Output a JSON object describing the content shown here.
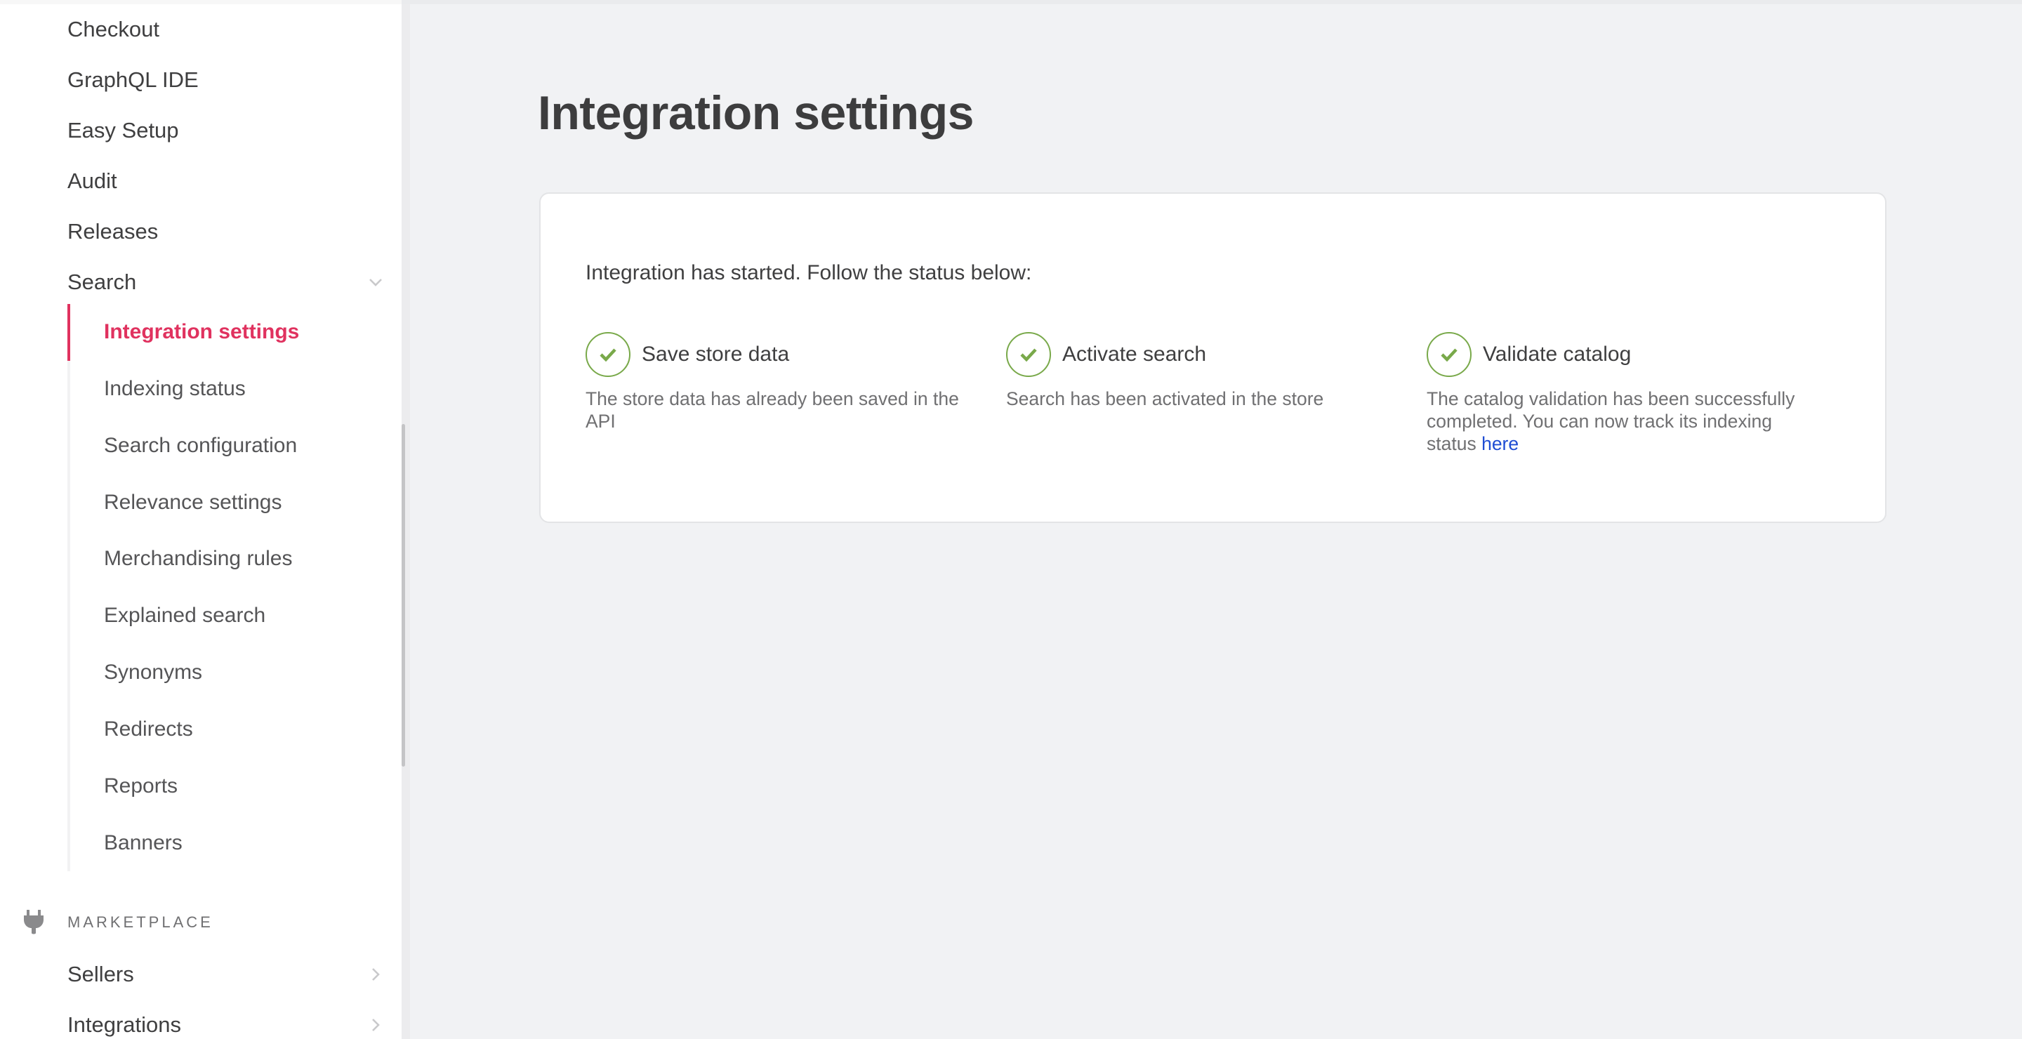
{
  "sidebar": {
    "top_items": [
      {
        "label": "Checkout"
      },
      {
        "label": "GraphQL IDE"
      },
      {
        "label": "Easy Setup"
      },
      {
        "label": "Audit"
      },
      {
        "label": "Releases"
      },
      {
        "label": "Search",
        "expanded": true,
        "icon": "chevron-down-icon"
      }
    ],
    "search_sub_items": [
      {
        "label": "Integration settings",
        "active": true
      },
      {
        "label": "Indexing status"
      },
      {
        "label": "Search configuration"
      },
      {
        "label": "Relevance settings"
      },
      {
        "label": "Merchandising rules"
      },
      {
        "label": "Explained search"
      },
      {
        "label": "Synonyms"
      },
      {
        "label": "Redirects"
      },
      {
        "label": "Reports"
      },
      {
        "label": "Banners"
      }
    ],
    "section": {
      "title": "MARKETPLACE",
      "icon": "plug-icon",
      "items": [
        {
          "label": "Sellers",
          "icon": "chevron-right-icon"
        },
        {
          "label": "Integrations",
          "icon": "chevron-right-icon"
        }
      ]
    }
  },
  "main": {
    "title": "Integration settings",
    "card": {
      "intro": "Integration has started. Follow the status below:",
      "steps": [
        {
          "title": "Save store data",
          "status": "complete",
          "icon": "check-circle-icon",
          "description": "The store data has already been saved in the API"
        },
        {
          "title": "Activate search",
          "status": "complete",
          "icon": "check-circle-icon",
          "description": "Search has been activated in the store"
        },
        {
          "title": "Validate catalog",
          "status": "complete",
          "icon": "check-circle-icon",
          "description": "The catalog validation has been successfully completed. You can now track its indexing status",
          "link_label": "here"
        }
      ]
    }
  },
  "colors": {
    "accent": "#e0325f",
    "success": "#79a94a",
    "link": "#1f4dd3",
    "background": "#f1f2f4"
  }
}
